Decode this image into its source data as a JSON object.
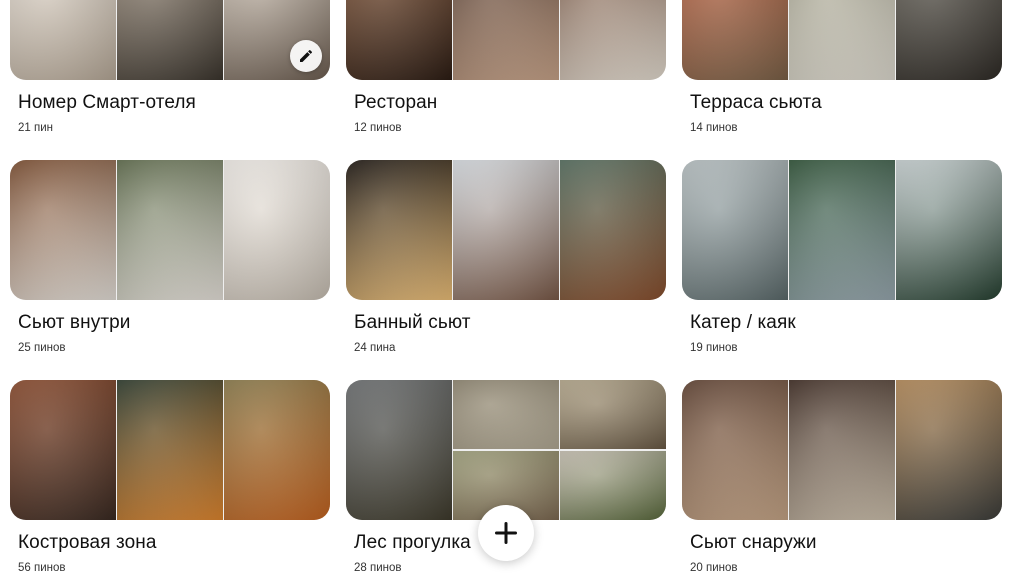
{
  "boards": [
    {
      "title": "Номер Смарт-отеля",
      "count": "21 пин",
      "tiles": [
        [
          "#e4ddd4",
          "#b8aa99"
        ],
        [
          "#a49584",
          "#3c362e"
        ],
        [
          "#ddd3c6",
          "#6c5d50"
        ]
      ]
    },
    {
      "title": "Ресторан",
      "count": "12 пинов",
      "tiles": [
        [
          "#8a5b3c",
          "#2d1d14"
        ],
        [
          "#4a3328",
          "#caa58a"
        ],
        [
          "#6e4b38",
          "#e7dfd3"
        ]
      ]
    },
    {
      "title": "Терраса сьюта",
      "count": "14 пинов",
      "tiles": [
        [
          "#c0603f",
          "#7c6248"
        ],
        [
          "#9c9a85",
          "#e2ded3"
        ],
        [
          "#6e6a60",
          "#2e2a25"
        ]
      ]
    },
    {
      "title": "Сьют внутри",
      "count": "25 пинов",
      "tiles": [
        [
          "#7a4b2d",
          "#e8e3dc"
        ],
        [
          "#5d6a4a",
          "#ebe6df"
        ],
        [
          "#f1ede8",
          "#c8bfb3"
        ]
      ]
    },
    {
      "title": "Банный сьют",
      "count": "24 пина",
      "tiles": [
        [
          "#1a140f",
          "#f0c27a"
        ],
        [
          "#d8dde2",
          "#7b5a48"
        ],
        [
          "#546d5e",
          "#8a4f2d"
        ]
      ]
    },
    {
      "title": "Катер / каяк",
      "count": "19 пинов",
      "tiles": [
        [
          "#b9c2c4",
          "#5c6b6c"
        ],
        [
          "#2e5236",
          "#9aaab2"
        ],
        [
          "#c9d2d3",
          "#254030"
        ]
      ]
    },
    {
      "title": "Костровая зона",
      "count": "56 пинов",
      "tiles": [
        [
          "#8b4a2c",
          "#3a2a22"
        ],
        [
          "#2c3a2c",
          "#e2882f"
        ],
        [
          "#8a7a4a",
          "#c6641f"
        ]
      ]
    },
    {
      "title": "Лес прогулка",
      "count": "28 пинов",
      "tiles": [
        [
          "#6b6e70",
          "#3f3b2c"
        ],
        [
          "#8e8570",
          "#b4ab96"
        ],
        [
          "#9fa07b",
          "#7e6a52"
        ],
        [
          "#b5a88c",
          "#6a5a45"
        ],
        [
          "#c7c0b2",
          "#5a6a3c"
        ]
      ]
    },
    {
      "title": "Сьют снаружи",
      "count": "20 пинов",
      "tiles": [
        [
          "#5e4030",
          "#c8a788"
        ],
        [
          "#3e2b22",
          "#cfc2ae"
        ],
        [
          "#b58a58",
          "#3c3d3a"
        ]
      ]
    }
  ],
  "icons": {
    "edit": "pencil-icon",
    "add": "plus-icon"
  },
  "colors": {
    "text": "#111111",
    "count_text": "#333333",
    "tile_bg": "#efefef"
  }
}
